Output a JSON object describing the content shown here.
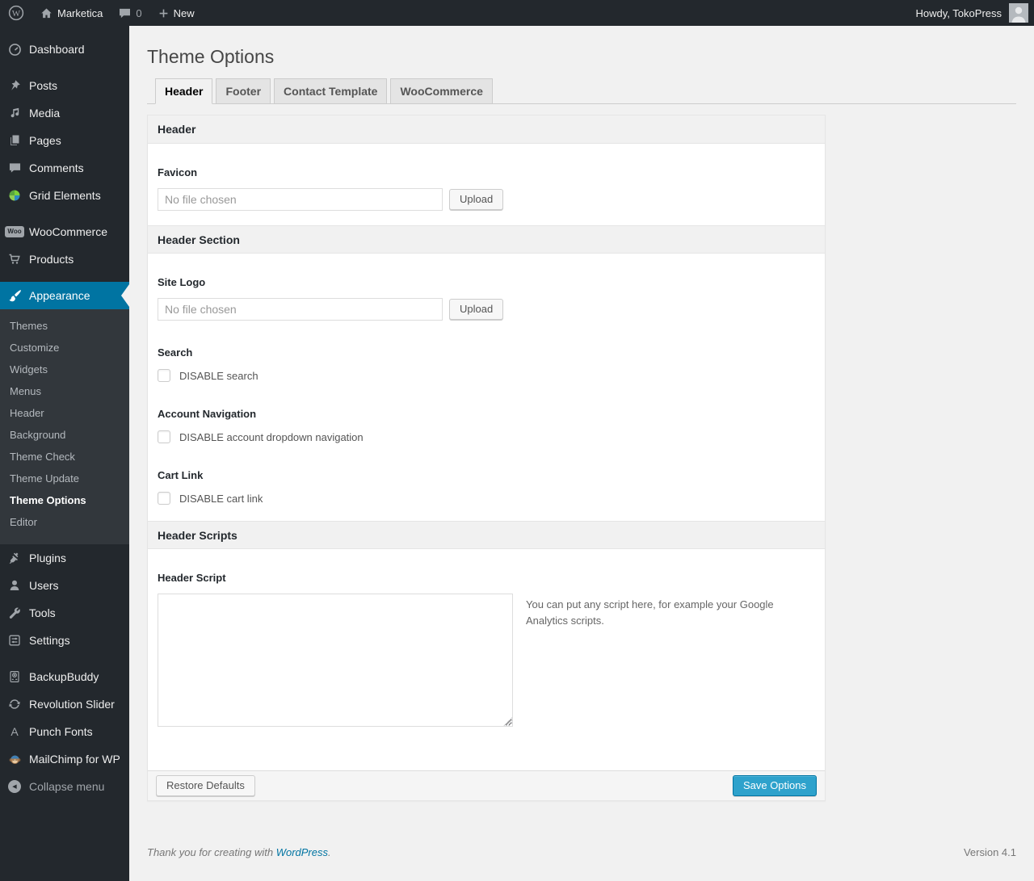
{
  "admin_bar": {
    "wp_logo_letter": "W",
    "site_name": "Marketica",
    "comments_count": "0",
    "new_label": "New",
    "howdy_text": "Howdy, TokoPress"
  },
  "sidebar": {
    "menu": [
      {
        "label": "Dashboard"
      },
      {
        "label": "Posts"
      },
      {
        "label": "Media"
      },
      {
        "label": "Pages"
      },
      {
        "label": "Comments"
      },
      {
        "label": "Grid Elements"
      },
      {
        "label": "WooCommerce"
      },
      {
        "label": "Products"
      },
      {
        "label": "Appearance"
      },
      {
        "label": "Plugins"
      },
      {
        "label": "Users"
      },
      {
        "label": "Tools"
      },
      {
        "label": "Settings"
      },
      {
        "label": "BackupBuddy"
      },
      {
        "label": "Revolution Slider"
      },
      {
        "label": "Punch Fonts"
      },
      {
        "label": "MailChimp for WP"
      },
      {
        "label": "Collapse menu"
      }
    ],
    "woo_badge": "Woo",
    "punch_fonts_letter": "A",
    "appearance_submenu": [
      {
        "label": "Themes"
      },
      {
        "label": "Customize"
      },
      {
        "label": "Widgets"
      },
      {
        "label": "Menus"
      },
      {
        "label": "Header"
      },
      {
        "label": "Background"
      },
      {
        "label": "Theme Check"
      },
      {
        "label": "Theme Update"
      },
      {
        "label": "Theme Options"
      },
      {
        "label": "Editor"
      }
    ]
  },
  "main": {
    "page_title": "Theme Options",
    "tabs": [
      {
        "label": "Header"
      },
      {
        "label": "Footer"
      },
      {
        "label": "Contact Template"
      },
      {
        "label": "WooCommerce"
      }
    ],
    "panel": {
      "section_header": {
        "title": "Header"
      },
      "favicon": {
        "label": "Favicon",
        "value": "No file chosen",
        "button": "Upload"
      },
      "section_header_section": {
        "title": "Header Section"
      },
      "site_logo": {
        "label": "Site Logo",
        "value": "No file chosen",
        "button": "Upload"
      },
      "search": {
        "label": "Search",
        "checkbox_label": "DISABLE search"
      },
      "account_nav": {
        "label": "Account Navigation",
        "checkbox_label": "DISABLE account dropdown navigation"
      },
      "cart_link": {
        "label": "Cart Link",
        "checkbox_label": "DISABLE cart link"
      },
      "section_header_scripts": {
        "title": "Header Scripts"
      },
      "header_script": {
        "label": "Header Script",
        "help": "You can put any script here, for example your Google Analytics scripts."
      },
      "footer": {
        "restore_button": "Restore Defaults",
        "save_button": "Save Options"
      }
    },
    "page_footer": {
      "thanks_prefix": "Thank you for creating with ",
      "wordpress_link": "WordPress",
      "thanks_suffix": ".",
      "version": "Version 4.1"
    }
  },
  "colors": {
    "accent_blue": "#0074a2",
    "primary_button": "#2ea2cc",
    "admin_bg": "#23282d",
    "submenu_bg": "#32373c",
    "page_bg": "#f1f1f1"
  }
}
